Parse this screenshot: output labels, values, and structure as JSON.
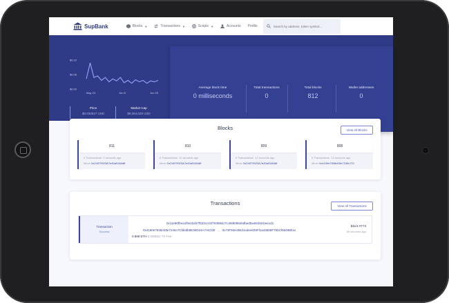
{
  "brand": {
    "name": "SupBank"
  },
  "nav": {
    "items": [
      {
        "label": "Blocks",
        "icon": "cube-icon",
        "dropdown": true
      },
      {
        "label": "Transactions",
        "icon": "arrows-icon",
        "dropdown": true
      },
      {
        "label": "Scripts",
        "icon": "globe-icon",
        "dropdown": true
      },
      {
        "label": "Accounts",
        "icon": "user-icon",
        "dropdown": false
      },
      {
        "label": "Profile",
        "icon": "",
        "dropdown": false
      }
    ],
    "search_placeholder": "Search by address, token symbol..."
  },
  "chart_data": {
    "type": "line",
    "title": "",
    "xlabel": "",
    "ylabel": "",
    "x_ticks": [
      "May 23",
      "Jun 6",
      "Jun 20"
    ],
    "y_ticks": [
      "$0.10",
      "$0.05",
      "$0.00"
    ],
    "ylim": [
      0,
      0.1
    ],
    "series": [
      {
        "values": [
          0.035,
          0.09,
          0.04,
          0.045,
          0.03,
          0.04,
          0.025,
          0.035,
          0.028,
          0.04,
          0.022,
          0.03,
          0.02,
          0.032,
          0.025,
          0.03,
          0.02,
          0.028,
          0.025,
          0.03
        ]
      }
    ],
    "color": "#8f9cf5",
    "grid": false
  },
  "market": {
    "price_label": "Price",
    "price_value": "$0.034517 USD",
    "cap_label": "Market Cap",
    "cap_value": "$8,354,028 USD"
  },
  "stats": [
    {
      "label": "Average block time",
      "value": "0 milliseconds"
    },
    {
      "label": "Total transactions",
      "value": "0"
    },
    {
      "label": "Total blocks",
      "value": "812"
    },
    {
      "label": "Wallet addresses",
      "value": "0"
    }
  ],
  "blocks_section": {
    "title": "Blocks",
    "view_all": "View All Blocks",
    "items": [
      {
        "number": "811",
        "tx": "0 Transactions",
        "ago": "0 seconds ago",
        "miner_label": "Miner",
        "miner": "0x24079923A7e45af14848f"
      },
      {
        "number": "810",
        "tx": "0 Transactions",
        "ago": "11 seconds ago",
        "miner_label": "Miner",
        "miner": "0x24079923A7e45af14848f"
      },
      {
        "number": "809",
        "tx": "0 Transactions",
        "ago": "12 seconds ago",
        "miner_label": "Miner",
        "miner": "0x24079923A7e45af14848f"
      },
      {
        "number": "808",
        "tx": "0 Transactions",
        "ago": "13 seconds ago",
        "miner_label": "Miner",
        "miner": "0x4190e7838cE8e7245c7Cf"
      }
    ]
  },
  "transactions_section": {
    "title": "Transactions",
    "view_all": "View All Transactions",
    "items": [
      {
        "type": "Transaction",
        "status": "Success",
        "hash": "0x11e90fbea1f0e1bd47f523cc01f78388dc7cc66809946dbed0a48cb0cbee1d1",
        "from": "0x4190e7838cE8e7245c7Cfdedb9E38D24A7A67d0",
        "to": "0x73F50ec9Ed1edee628Ff1a43608F7bbCf9d488b1e",
        "arrow": "→",
        "amount": "0.888 ETH",
        "fee": "0.000021 TX Fee",
        "block": "Block #773",
        "ago": "59 seconds ago"
      }
    ]
  }
}
